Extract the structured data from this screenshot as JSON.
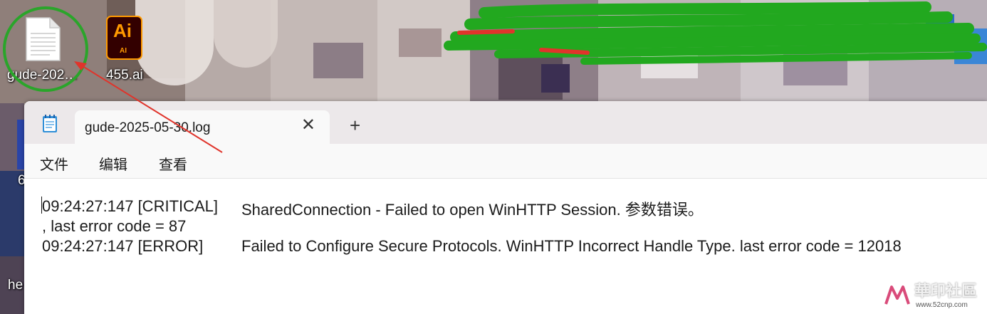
{
  "desktop": {
    "icons": [
      {
        "name": "log-file",
        "label": "gude-202…"
      },
      {
        "name": "illustrator-file",
        "label": "455.ai",
        "badge": "Ai",
        "badge_sub": "AI"
      }
    ],
    "partial_labels": {
      "left_6": "6",
      "left_he": "he"
    }
  },
  "window": {
    "tab_title": "gude-2025-05-30.log",
    "menu": [
      "文件",
      "编辑",
      "查看"
    ]
  },
  "log": {
    "line1_time": "09:24:27:147 [CRITICAL]",
    "line1_msg": "SharedConnection - Failed to open WinHTTP Session. 参数错误。",
    "line2": ", last error code = 87",
    "line3_time": "09:24:27:147 [ERROR]",
    "line3_msg": "Failed to Configure Secure Protocols. WinHTTP Incorrect Handle Type. last error code = 12018"
  },
  "watermark": {
    "title": "華印社區",
    "url": "www.52cnp.com"
  },
  "colors": {
    "annotation_circle": "#2aa52a",
    "arrow": "#e0342b",
    "scribble": "#22a81f",
    "ai_orange": "#ff9a00",
    "ai_bg": "#330000"
  }
}
